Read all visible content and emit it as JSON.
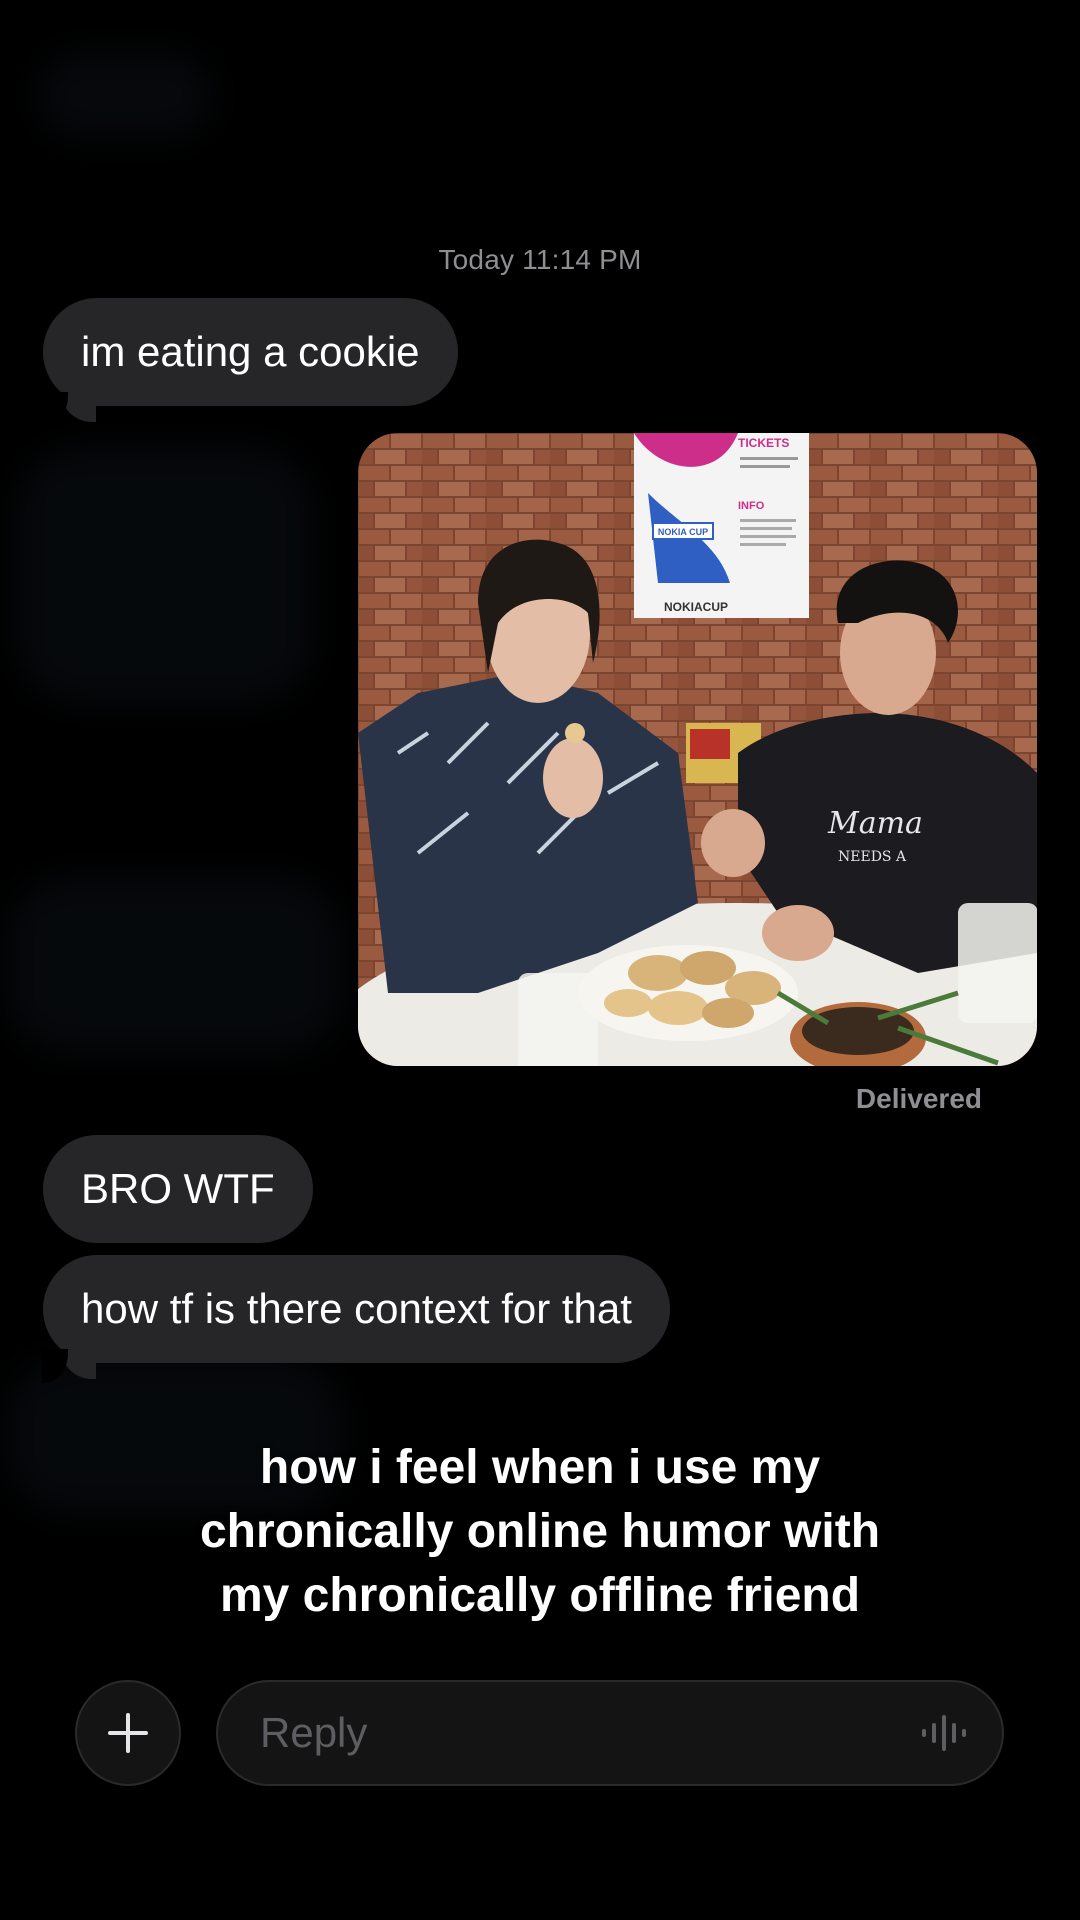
{
  "conversation": {
    "timestamp": "Today 11:14 PM",
    "messages": [
      {
        "text": "im eating a cookie"
      },
      {
        "text": "BRO WTF"
      },
      {
        "text": "how tf is there context for that"
      }
    ],
    "sent_photo": {
      "poster_tickets": "TICKETS",
      "poster_info": "INFO",
      "poster_badge": "NOKIA CUP",
      "poster_footer": "NOKIACUP",
      "shirt_text_1": "Mama",
      "shirt_text_2": "NEEDS A"
    },
    "delivery_status": "Delivered"
  },
  "caption": {
    "lines": [
      "how i feel when i use my",
      "chronically online humor with",
      "my chronically offline friend"
    ]
  },
  "composer": {
    "plus_icon": "plus-icon",
    "reply_placeholder": "Reply",
    "voice_icon": "waveform-icon"
  },
  "colors": {
    "incoming_bubble": "#262628",
    "background": "#000000",
    "meta_text": "#8e8e93"
  }
}
